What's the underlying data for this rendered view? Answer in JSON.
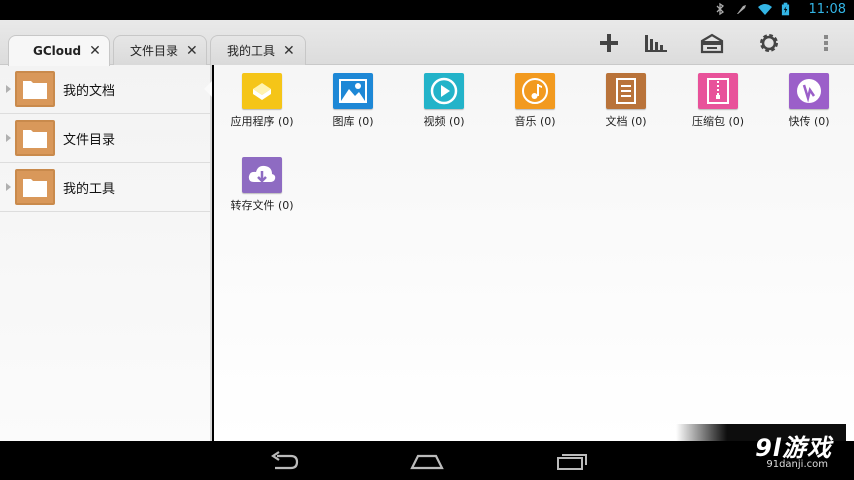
{
  "status_bar": {
    "time": "11:08",
    "icons": [
      "bluetooth-icon",
      "mute-icon",
      "wifi-icon",
      "battery-icon"
    ],
    "accent_color": "#33b5e5"
  },
  "tabs": [
    {
      "label": "GCloud",
      "close": "✕",
      "active": true
    },
    {
      "label": "文件目录",
      "close": "✕",
      "active": false
    },
    {
      "label": "我的工具",
      "close": "✕",
      "active": false
    }
  ],
  "toolbar": {
    "icons": [
      "add-icon",
      "chart-icon",
      "cloud-box-icon",
      "settings-icon",
      "overflow-menu-icon"
    ]
  },
  "sidebar": {
    "items": [
      {
        "label": "我的文档",
        "selected": true
      },
      {
        "label": "文件目录",
        "selected": false
      },
      {
        "label": "我的工具",
        "selected": false
      }
    ]
  },
  "categories": [
    {
      "label": "应用程序 (0)",
      "icon": "apps-icon",
      "color": "#f5c518"
    },
    {
      "label": "图库 (0)",
      "icon": "gallery-icon",
      "color": "#1e88d6"
    },
    {
      "label": "视频 (0)",
      "icon": "video-icon",
      "color": "#23b3c9"
    },
    {
      "label": "音乐 (0)",
      "icon": "music-icon",
      "color": "#f29a1f"
    },
    {
      "label": "文档 (0)",
      "icon": "document-icon",
      "color": "#b9733a"
    },
    {
      "label": "压缩包 (0)",
      "icon": "archive-icon",
      "color": "#e8529a"
    },
    {
      "label": "快传 (0)",
      "icon": "quick-transfer-icon",
      "color": "#9b5fc9"
    },
    {
      "label": "转存文件 (0)",
      "icon": "download-icon",
      "color": "#8e6bc2"
    }
  ],
  "watermark": {
    "main": "9l游戏",
    "sub": "91danji.com"
  }
}
